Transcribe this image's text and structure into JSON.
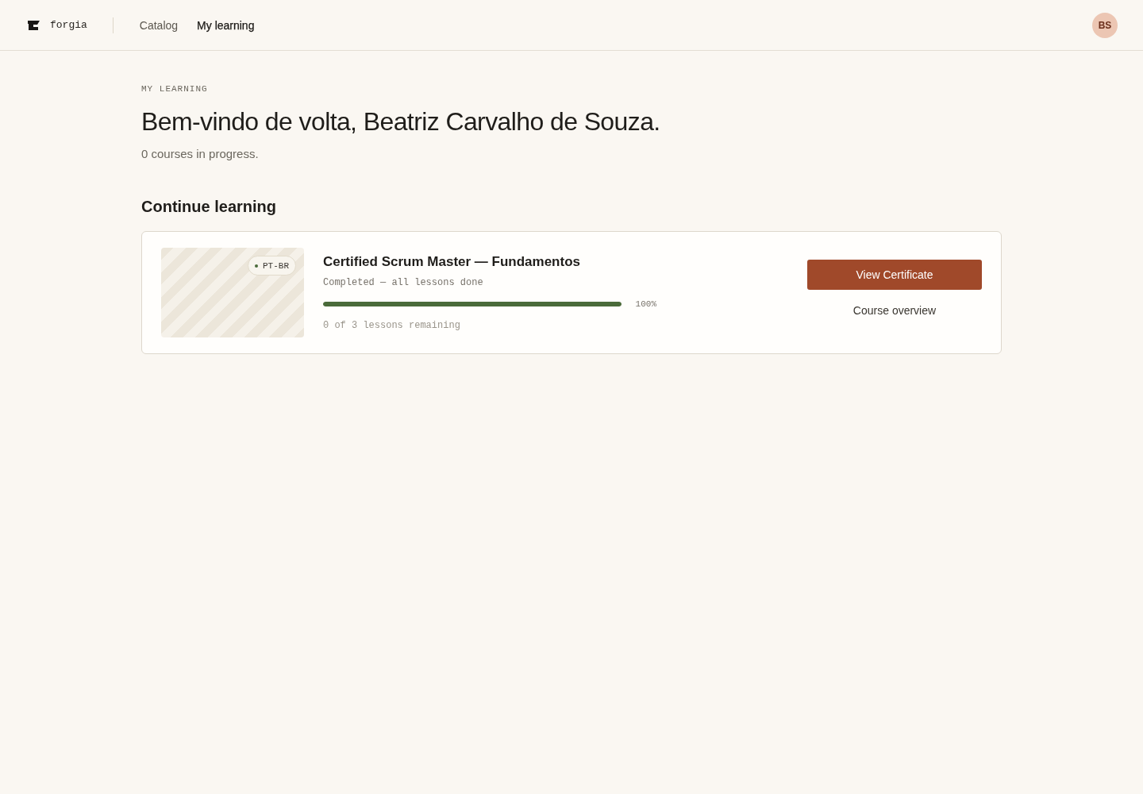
{
  "header": {
    "logo": "forgia",
    "nav": [
      {
        "label": "Catalog",
        "selected": false
      },
      {
        "label": "My learning",
        "selected": true
      }
    ],
    "avatar": "BS"
  },
  "page": {
    "eyebrow": "MY LEARNING",
    "title": "Bem-vindo de volta, Beatriz Carvalho de Souza.",
    "summary": "0 courses in progress."
  },
  "section": {
    "title": "Continue learning",
    "courses": [
      {
        "title": "Certified Scrum Master — Fundamentos",
        "language": "PT-BR",
        "status": "Completed — all lessons done",
        "level": 1,
        "percent": "100%",
        "remaining": "0 of 3 lessons remaining",
        "primary_action": "View Certificate",
        "secondary_action": "Course overview"
      }
    ]
  }
}
